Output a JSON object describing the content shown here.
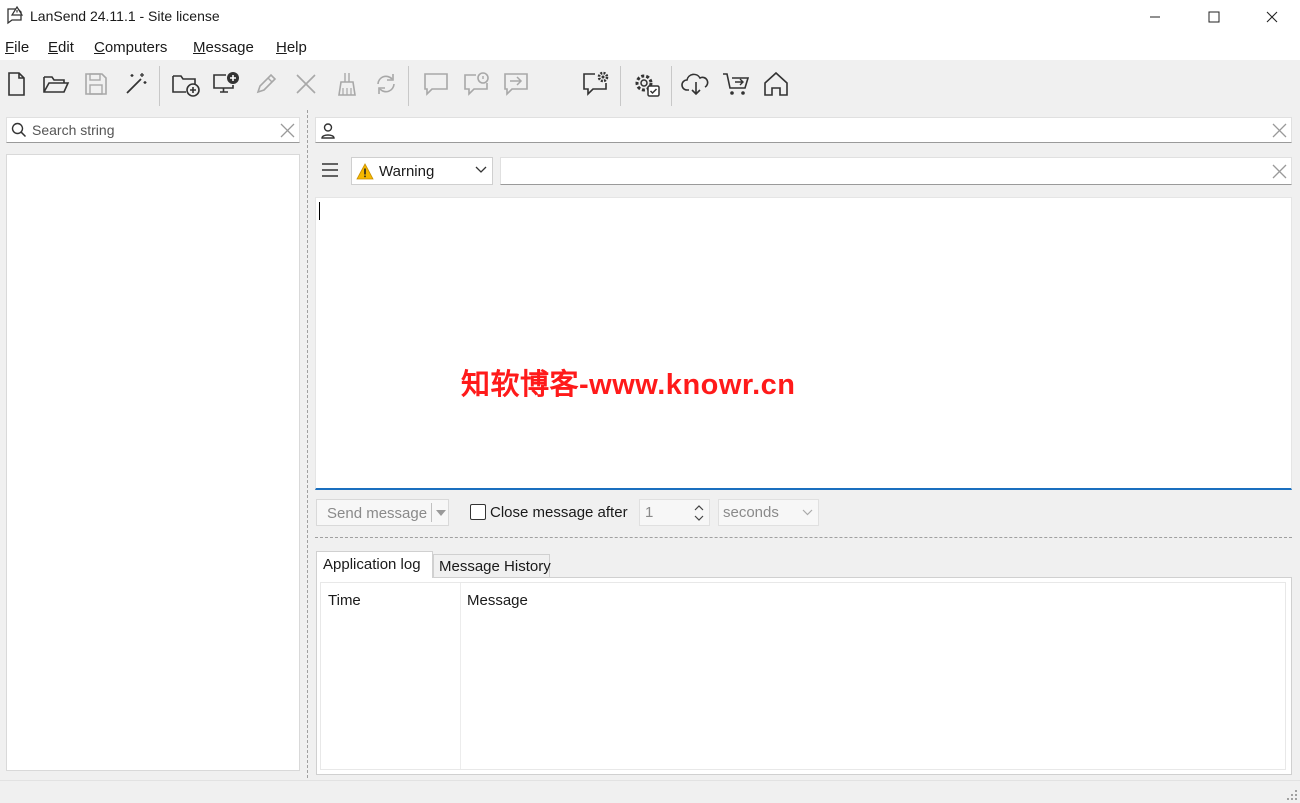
{
  "window": {
    "title": "LanSend 24.11.1 - Site license",
    "app_icon": "speech-bubble-warning-icon",
    "controls": [
      "minimize-icon",
      "maximize-icon",
      "close-icon"
    ]
  },
  "menu": [
    {
      "label": "File",
      "mnemonic": "F",
      "rest": "ile"
    },
    {
      "label": "Edit",
      "mnemonic": "E",
      "rest": "dit"
    },
    {
      "label": "Computers",
      "mnemonic": "C",
      "rest": "omputers"
    },
    {
      "label": "Message",
      "mnemonic": "M",
      "rest": "essage"
    },
    {
      "label": "Help",
      "mnemonic": "H",
      "rest": "elp"
    }
  ],
  "toolbar": {
    "buttons": [
      {
        "icon": "new-file-icon",
        "enabled": true
      },
      {
        "icon": "open-folder-icon",
        "enabled": true
      },
      {
        "icon": "save-icon",
        "enabled": false
      },
      {
        "icon": "magic-wand-icon",
        "enabled": true
      },
      {
        "icon": "add-folder-icon",
        "enabled": true
      },
      {
        "icon": "add-computer-icon",
        "enabled": true
      },
      {
        "icon": "edit-pencil-icon",
        "enabled": false
      },
      {
        "icon": "delete-x-icon",
        "enabled": false
      },
      {
        "icon": "broom-clean-icon",
        "enabled": false
      },
      {
        "icon": "refresh-icon",
        "enabled": false
      },
      {
        "icon": "message-bubble-icon",
        "enabled": false
      },
      {
        "icon": "message-status-icon",
        "enabled": false
      },
      {
        "icon": "message-forward-icon",
        "enabled": false
      },
      {
        "icon": "message-settings-icon",
        "enabled": true
      },
      {
        "icon": "settings-gear-icon",
        "enabled": true
      },
      {
        "icon": "cloud-download-icon",
        "enabled": true
      },
      {
        "icon": "shopping-cart-icon",
        "enabled": true
      },
      {
        "icon": "home-icon",
        "enabled": true
      }
    ]
  },
  "search": {
    "placeholder": "Search string",
    "icon": "search-icon"
  },
  "recipient": {
    "icon": "user-icon",
    "value": ""
  },
  "message_type": {
    "selected": "Warning",
    "icon": "warning-triangle-icon"
  },
  "subject": {
    "value": ""
  },
  "message_body": {
    "value": "",
    "watermark": "知软博客-www.knowr.cn"
  },
  "send": {
    "button_label": "Send message",
    "enabled": false
  },
  "auto_close": {
    "label": "Close message after",
    "checked": false,
    "amount": "1",
    "unit": "seconds"
  },
  "tabs": [
    {
      "label": "Application log",
      "active": true
    },
    {
      "label": "Message History",
      "active": false
    }
  ],
  "log_table": {
    "columns": [
      "Time",
      "Message"
    ],
    "rows": []
  },
  "colors": {
    "accent": "#1a6fbf",
    "warning": "#f5b800",
    "watermark": "#ff1a1a"
  }
}
